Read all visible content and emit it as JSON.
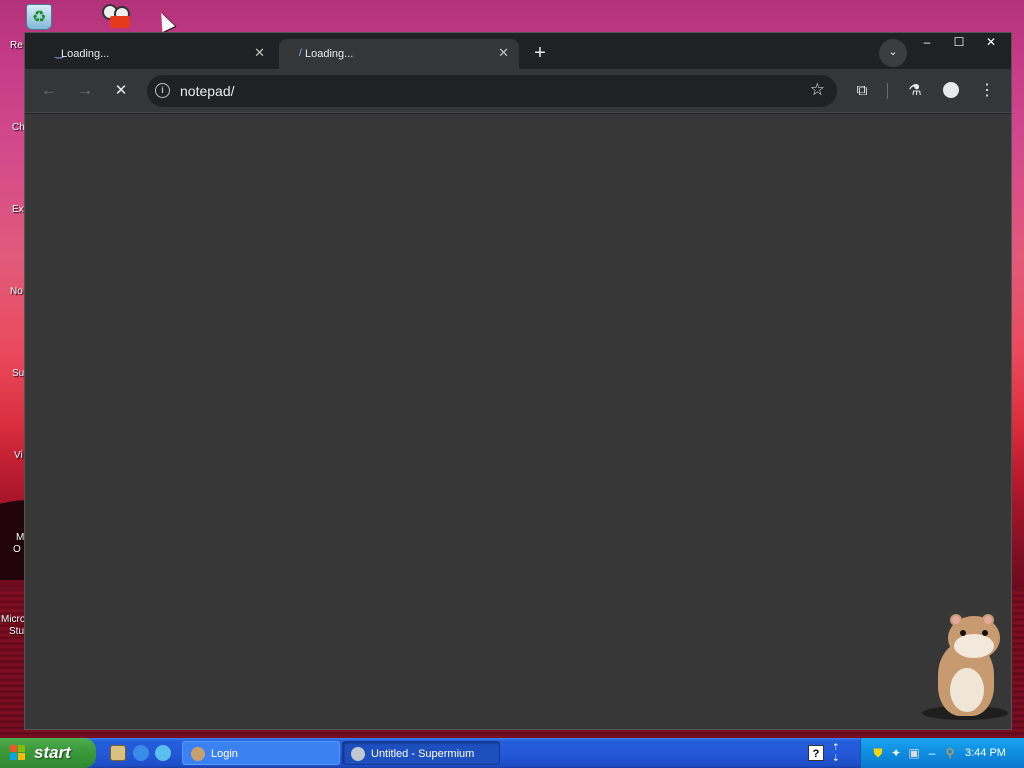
{
  "desktop": {
    "icon_labels": [
      "Re",
      "Ch",
      "Ex",
      "No",
      "Su",
      "Vi",
      "M",
      "O",
      "Micro",
      "Stu"
    ]
  },
  "browser": {
    "tabs": [
      {
        "title": "Loading...",
        "active": false
      },
      {
        "title": "Loading...",
        "active": true
      }
    ],
    "new_tab_symbol": "+",
    "tab_close_symbol": "✕",
    "tab_search_symbol": "⌄",
    "window_controls": {
      "minimize": "–",
      "maximize": "☐",
      "close": "✕"
    },
    "toolbar": {
      "back_icon": "←",
      "forward_icon": "→",
      "stop_icon": "✕",
      "info_icon": "i",
      "url": "notepad/",
      "star_icon": "☆",
      "extensions_icon": "⧉",
      "labs_icon": "⚗",
      "menu_icon": "⋮"
    }
  },
  "taskbar": {
    "start_label": "start",
    "buttons": [
      {
        "label": "Login",
        "active": false
      },
      {
        "label": "Untitled - Supermium",
        "active": true
      }
    ],
    "help_icon": "?",
    "clock": "3:44 PM"
  },
  "colors": {
    "browser_bg": "#202124",
    "toolbar_bg": "#35363a",
    "content_bg": "#373737",
    "taskbar_blue": "#245edb",
    "start_green": "#3c9a3c",
    "tray_blue": "#0f8de0"
  }
}
